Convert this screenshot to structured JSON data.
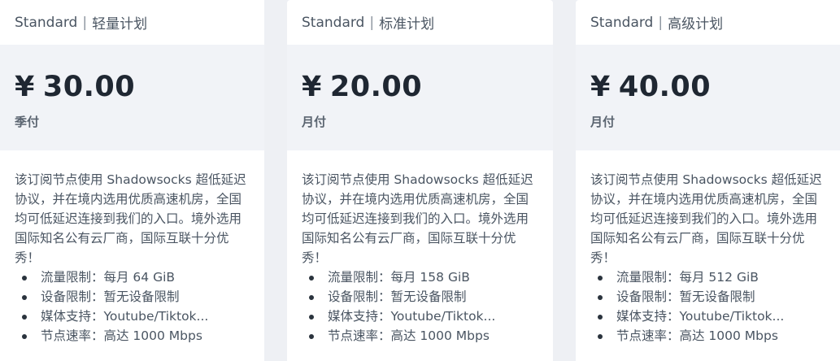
{
  "plans": [
    {
      "header": {
        "tier": "Standard",
        "separator": "|",
        "name": "轻量计划"
      },
      "price": {
        "currency": "¥",
        "amount": "30.00"
      },
      "period": "季付",
      "description": "该订阅节点使用 Shadowsocks 超低延迟协议，并在境内选用优质高速机房，全国均可低延迟连接到我们的入口。境外选用国际知名公有云厂商，国际互联十分优秀！",
      "features": [
        "流量限制：每月 64 GiB",
        "设备限制：暂无设备限制",
        "媒体支持：Youtube/Tiktok...",
        "节点速率：高达 1000 Mbps"
      ]
    },
    {
      "header": {
        "tier": "Standard",
        "separator": "|",
        "name": "标准计划"
      },
      "price": {
        "currency": "¥",
        "amount": "20.00"
      },
      "period": "月付",
      "description": "该订阅节点使用 Shadowsocks 超低延迟协议，并在境内选用优质高速机房，全国均可低延迟连接到我们的入口。境外选用国际知名公有云厂商，国际互联十分优秀！",
      "features": [
        "流量限制：每月 158 GiB",
        "设备限制：暂无设备限制",
        "媒体支持：Youtube/Tiktok...",
        "节点速率：高达 1000 Mbps"
      ]
    },
    {
      "header": {
        "tier": "Standard",
        "separator": "|",
        "name": "高级计划"
      },
      "price": {
        "currency": "¥",
        "amount": "40.00"
      },
      "period": "月付",
      "description": "该订阅节点使用 Shadowsocks 超低延迟协议，并在境内选用优质高速机房，全国均可低延迟连接到我们的入口。境外选用国际知名公有云厂商，国际互联十分优秀！",
      "features": [
        "流量限制：每月 512 GiB",
        "设备限制：暂无设备限制",
        "媒体支持：Youtube/Tiktok...",
        "节点速率：高达 1000 Mbps"
      ]
    }
  ]
}
